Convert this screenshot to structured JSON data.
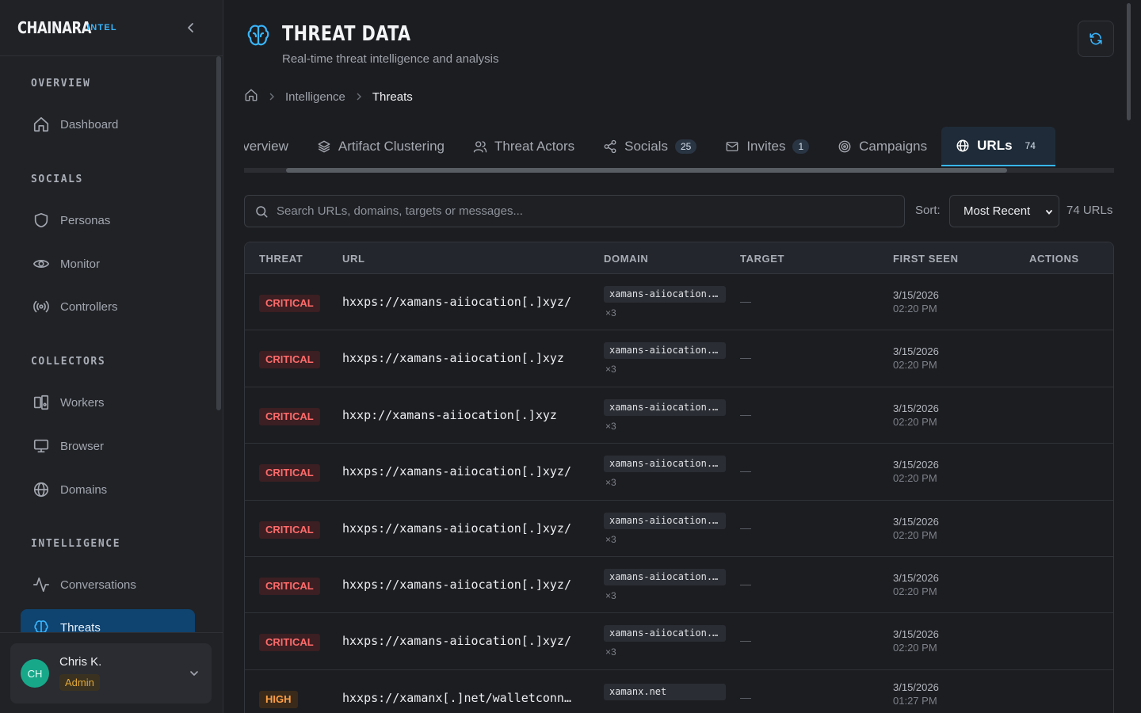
{
  "brand": {
    "name": "CHAINARA",
    "tag": "INTEL"
  },
  "sidebar": {
    "sections": [
      {
        "title": "OVERVIEW",
        "items": [
          {
            "label": "Dashboard",
            "icon": "home-icon"
          }
        ]
      },
      {
        "title": "SOCIALS",
        "items": [
          {
            "label": "Personas",
            "icon": "shield-icon"
          },
          {
            "label": "Monitor",
            "icon": "eye-icon"
          },
          {
            "label": "Controllers",
            "icon": "broadcast-icon"
          }
        ]
      },
      {
        "title": "COLLECTORS",
        "items": [
          {
            "label": "Workers",
            "icon": "devices-icon"
          },
          {
            "label": "Browser",
            "icon": "monitor-icon"
          },
          {
            "label": "Domains",
            "icon": "globe-icon"
          }
        ]
      },
      {
        "title": "INTELLIGENCE",
        "items": [
          {
            "label": "Conversations",
            "icon": "activity-icon"
          },
          {
            "label": "Threats",
            "icon": "brain-icon",
            "active": true
          }
        ]
      }
    ],
    "user": {
      "initials": "CH",
      "name": "Chris K.",
      "role": "Admin"
    }
  },
  "header": {
    "title": "THREAT DATA",
    "subtitle": "Real-time threat intelligence and analysis"
  },
  "breadcrumb": {
    "crumb1": "Intelligence",
    "current": "Threats"
  },
  "tabs": [
    {
      "label": "Overview",
      "icon": "grid-icon",
      "count": ""
    },
    {
      "label": "Artifact Clustering",
      "icon": "layers-icon",
      "count": ""
    },
    {
      "label": "Threat Actors",
      "icon": "users-icon",
      "count": ""
    },
    {
      "label": "Socials",
      "icon": "share-icon",
      "count": "25"
    },
    {
      "label": "Invites",
      "icon": "mail-icon",
      "count": "1"
    },
    {
      "label": "Campaigns",
      "icon": "target-icon",
      "count": ""
    },
    {
      "label": "URLs",
      "icon": "globe-icon",
      "count": "74",
      "active": true
    }
  ],
  "toolbar": {
    "search_placeholder": "Search URLs, domains, targets or messages...",
    "sort_label": "Sort:",
    "sort_value": "Most Recent",
    "url_count": "74 URLs"
  },
  "table": {
    "columns": {
      "threat": "THREAT",
      "url": "URL",
      "domain": "DOMAIN",
      "target": "TARGET",
      "first_seen": "FIRST SEEN",
      "actions": "ACTIONS"
    },
    "rows": [
      {
        "threat": "CRITICAL",
        "url": "hxxps://xamans-aiiocation[.]xyz/",
        "domain": "xamans-aiiocation.xyz",
        "domain_count": "×3",
        "target": "—",
        "date": "3/15/2026",
        "time": "02:20 PM"
      },
      {
        "threat": "CRITICAL",
        "url": "hxxps://xamans-aiiocation[.]xyz",
        "domain": "xamans-aiiocation.xyz",
        "domain_count": "×3",
        "target": "—",
        "date": "3/15/2026",
        "time": "02:20 PM"
      },
      {
        "threat": "CRITICAL",
        "url": "hxxp://xamans-aiiocation[.]xyz",
        "domain": "xamans-aiiocation.xyz",
        "domain_count": "×3",
        "target": "—",
        "date": "3/15/2026",
        "time": "02:20 PM"
      },
      {
        "threat": "CRITICAL",
        "url": "hxxps://xamans-aiiocation[.]xyz/",
        "domain": "xamans-aiiocation.xyz",
        "domain_count": "×3",
        "target": "—",
        "date": "3/15/2026",
        "time": "02:20 PM"
      },
      {
        "threat": "CRITICAL",
        "url": "hxxps://xamans-aiiocation[.]xyz/",
        "domain": "xamans-aiiocation.xyz",
        "domain_count": "×3",
        "target": "—",
        "date": "3/15/2026",
        "time": "02:20 PM"
      },
      {
        "threat": "CRITICAL",
        "url": "hxxps://xamans-aiiocation[.]xyz/",
        "domain": "xamans-aiiocation.xyz",
        "domain_count": "×3",
        "target": "—",
        "date": "3/15/2026",
        "time": "02:20 PM"
      },
      {
        "threat": "CRITICAL",
        "url": "hxxps://xamans-aiiocation[.]xyz/",
        "domain": "xamans-aiiocation.xyz",
        "domain_count": "×3",
        "target": "—",
        "date": "3/15/2026",
        "time": "02:20 PM"
      },
      {
        "threat": "HIGH",
        "url": "hxxps://xamanx[.]net/walletconnect",
        "domain": "xamanx.net",
        "domain_count": "",
        "target": "—",
        "date": "3/15/2026",
        "time": "01:27 PM"
      }
    ]
  },
  "colors": {
    "accent": "#38b6ff",
    "active_nav": "#0f4370",
    "critical": "#ff6b6b",
    "high": "#ff9f43",
    "admin": "#e2a93a"
  }
}
